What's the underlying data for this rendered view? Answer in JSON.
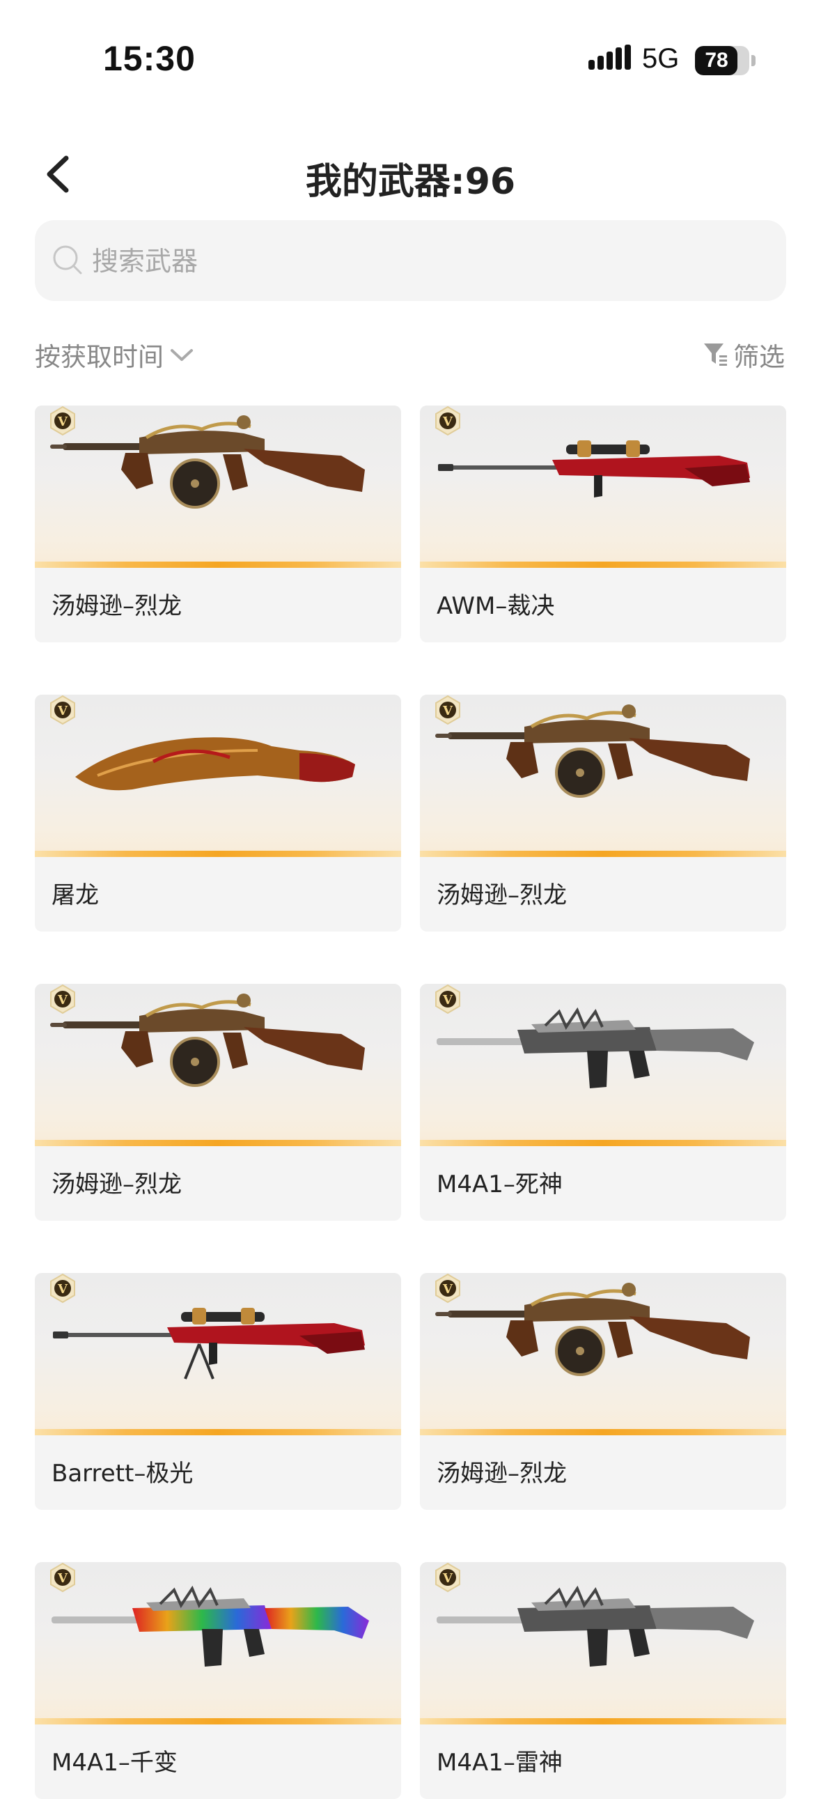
{
  "status_bar": {
    "time": "15:30",
    "network": "5G",
    "battery": "78",
    "battery_level": 0.78
  },
  "header": {
    "title": "我的武器:96"
  },
  "search": {
    "placeholder": "搜索武器"
  },
  "toolbar": {
    "sort_label": "按获取时间",
    "filter_label": "筛选"
  },
  "badge": "V",
  "weapons": [
    {
      "name": "汤姆逊–烈龙",
      "icon": "tommy-gun-icon"
    },
    {
      "name": "AWM–裁决",
      "icon": "sniper-rifle-icon"
    },
    {
      "name": "屠龙",
      "icon": "blade-icon"
    },
    {
      "name": "汤姆逊–烈龙",
      "icon": "tommy-gun-icon"
    },
    {
      "name": "汤姆逊–烈龙",
      "icon": "tommy-gun-icon"
    },
    {
      "name": "M4A1–死神",
      "icon": "assault-rifle-icon"
    },
    {
      "name": "Barrett–极光",
      "icon": "sniper-rifle-icon"
    },
    {
      "name": "汤姆逊–烈龙",
      "icon": "tommy-gun-icon"
    },
    {
      "name": "M4A1–千变",
      "icon": "assault-rifle-icon"
    },
    {
      "name": "M4A1–雷神",
      "icon": "assault-rifle-icon"
    }
  ],
  "colors": {
    "accent": "#f5a623",
    "card_bg": "#f4f4f4",
    "text": "#222222",
    "muted": "#888888"
  }
}
